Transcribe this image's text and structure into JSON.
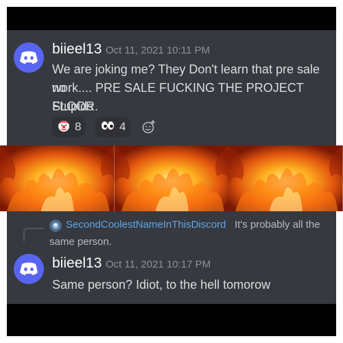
{
  "message1": {
    "author": "biieel13",
    "timestamp": "Oct 11, 2021 10:11 PM",
    "lines": [
      "We are joking me? They Don't learn that pre sale no",
      "work.... PRE SALE FUCKING THE PROJECT FLOOR.",
      "Stupids"
    ],
    "avatar_icon": "discord-logo-icon",
    "reactions": [
      {
        "emoji": "clown-face-icon",
        "count": "8"
      },
      {
        "emoji": "eyes-icon",
        "count": "4"
      }
    ],
    "add_reaction_icon": "add-reaction-icon"
  },
  "image": {
    "description_icon": "fire-icon",
    "tiles": 3
  },
  "message2": {
    "reply": {
      "author": "SecondCoolestNameInThisDiscord",
      "text_line1": "It's probably all the",
      "text_line2": "same person."
    },
    "author": "biieel13",
    "timestamp": "Oct 11, 2021 10:17 PM",
    "text": "Same person? Idiot, to  the  hell tomorow",
    "avatar_icon": "discord-logo-icon"
  },
  "colors": {
    "background": "#36393f",
    "username": "#ffffff",
    "timestamp": "#8e9297",
    "message": "#dcddde",
    "reply_author": "#5fa7e8",
    "blurple": "#5865f2",
    "reaction_bg": "#2f3136"
  }
}
